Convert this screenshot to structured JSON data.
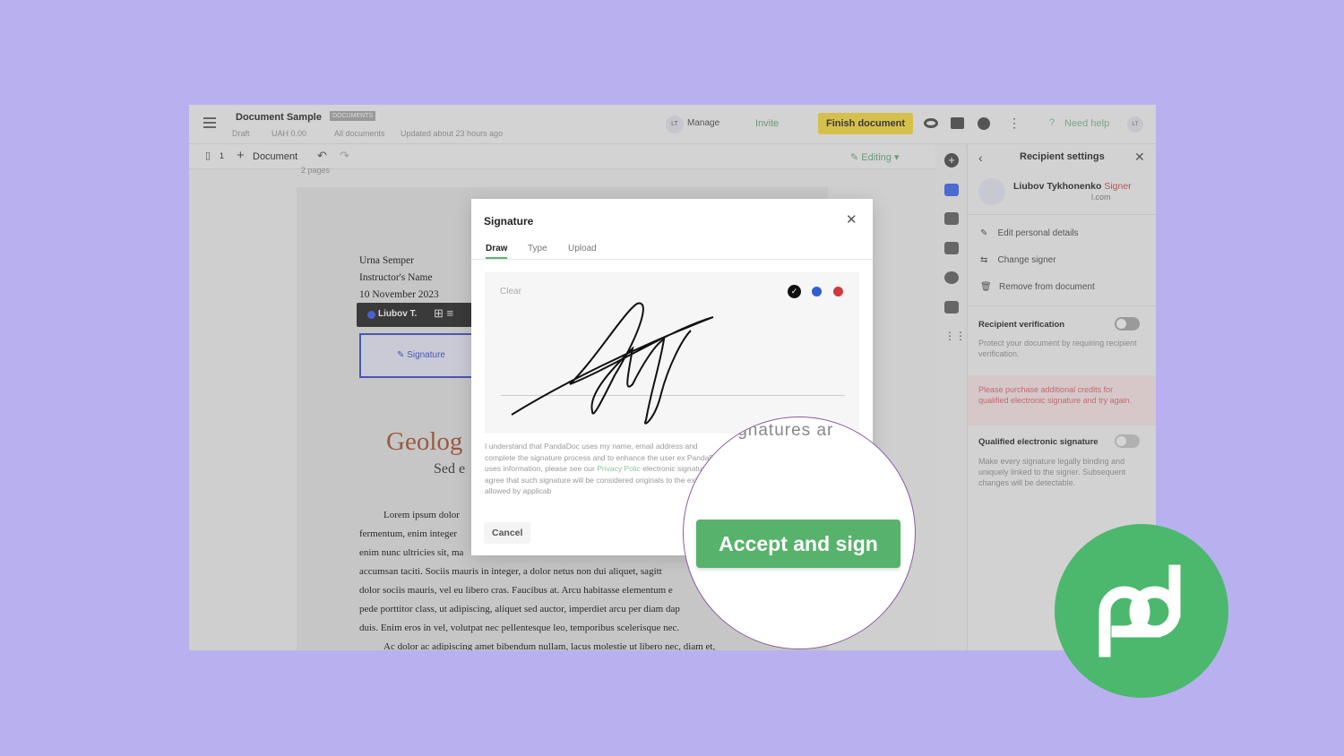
{
  "header": {
    "menu_icon": "hamburger-icon",
    "title": "Document Sample",
    "badge": "DOCUMENTS",
    "status": "Draft",
    "amount": "UAH 0.00",
    "folder": "All documents",
    "updated": "Updated about 23 hours ago",
    "avatar": "LT",
    "manage": "Manage",
    "invite": "Invite",
    "finish": "Finish document",
    "need_help": "Need help",
    "help_icon": "?",
    "avatar2": "LT"
  },
  "toolbar": {
    "pages_count": "1",
    "add_document": "Document",
    "editing": "Editing",
    "pages_label": "2 pages"
  },
  "document": {
    "lines_top": [
      "Urna Semper",
      "Instructor's Name",
      "10 November 2023"
    ],
    "signer_chip": "Liubov T.",
    "signature_field": "Signature",
    "title": "Geolog",
    "subtitle": "Sed e",
    "paragraphs": [
      "Lorem ipsum dolor",
      "fermentum, enim integer",
      "enim nunc ultricies sit, ma",
      "accumsan taciti. Sociis mauris in integer, a dolor netus non dui aliquet, sagitt",
      "dolor sociis mauris, vel eu libero cras. Faucibus at. Arcu habitasse elementum e",
      "pede porttitor class, ut adipiscing, aliquet sed auctor, imperdiet arcu per diam dap",
      "duis. Enim eros in vel, volutpat nec pellentesque leo, temporibus scelerisque nec.",
      "Ac dolor ac adipiscing amet bibendum nullam, lacus molestie ut libero nec, diam et,"
    ]
  },
  "panel": {
    "title": "Recipient settings",
    "name": "Liubov Tykhonenko",
    "role": "Signer",
    "email": "l.com",
    "actions": [
      "Edit personal details",
      "Change signer",
      "Remove from document"
    ],
    "verification_title": "Recipient verification",
    "verification_desc": "Protect your document by requiring recipient verification.",
    "verification_on": false,
    "warning": "Please purchase additional credits for qualified electronic signature and try again.",
    "qes_title": "Qualified electronic signature",
    "qes_desc": "Make every signature legally binding and uniquely linked to the signer. Subsequent changes will be detectable.",
    "qes_on": false
  },
  "modal": {
    "title": "Signature",
    "tabs": [
      "Draw",
      "Type",
      "Upload"
    ],
    "active_tab": "Draw",
    "clear": "Clear",
    "colors": [
      "#111111",
      "#2f5fd0",
      "#d03a3a"
    ],
    "selected_color": "#111111",
    "legal_before": "I understand that PandaDoc uses my name, email address and complete the signature process and to enhance the user ex PandaDoc uses information, please see our ",
    "privacy": "Privacy Polic",
    "legal_after": " electronic signature, I agree that such signature will be considered originals to the extent allowed by applicab",
    "cancel": "Cancel"
  },
  "magnifier": {
    "snippet": "ignatures ar",
    "accept": "Accept and sign"
  },
  "colors": {
    "background": "#b9b1ef",
    "brand_green": "#4bb86e",
    "finish_yellow": "#e8c84a"
  }
}
